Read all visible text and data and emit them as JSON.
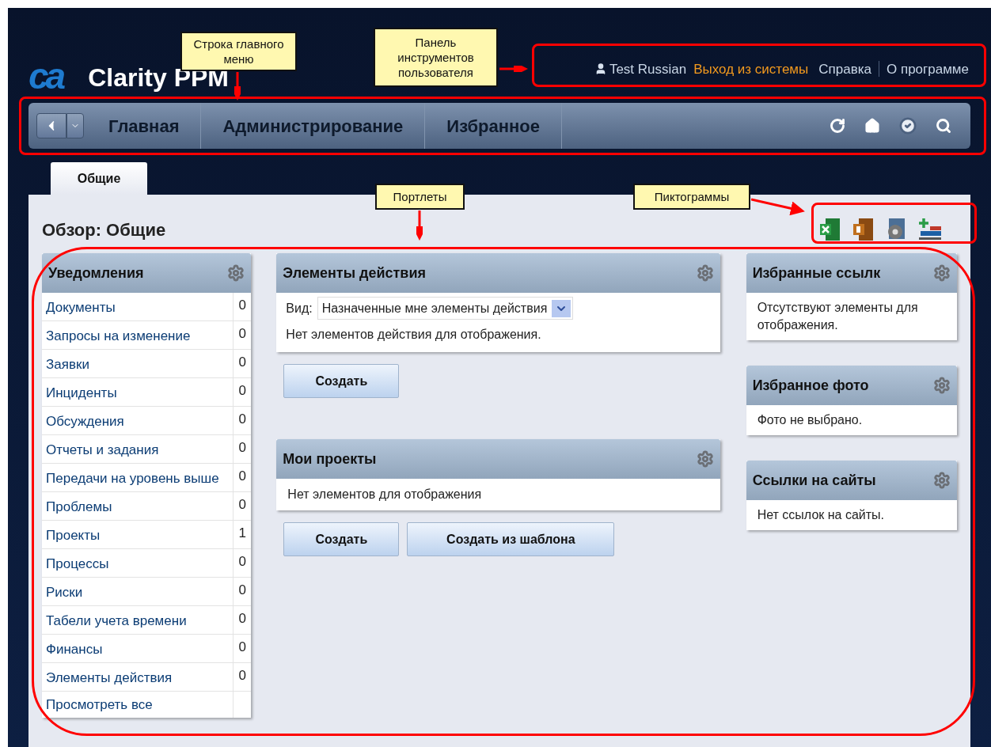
{
  "header": {
    "logo": "ca",
    "product": "Clarity PPM"
  },
  "user_toolbar": {
    "user": "Test Russian",
    "links": [
      {
        "label": "Выход из системы",
        "kind": "logout"
      },
      {
        "label": "Справка",
        "kind": "link"
      },
      {
        "label": "О программе",
        "kind": "link"
      }
    ]
  },
  "main_menu": {
    "items": [
      "Главная",
      "Администрирование",
      "Избранное"
    ]
  },
  "tabs": [
    {
      "label": "Общие",
      "selected": true
    }
  ],
  "page_title": "Обзор: Общие",
  "notifications": {
    "title": "Уведомления",
    "rows": [
      {
        "label": "Документы",
        "count": "0"
      },
      {
        "label": "Запросы на изменение",
        "count": "0"
      },
      {
        "label": "Заявки",
        "count": "0"
      },
      {
        "label": "Инциденты",
        "count": "0"
      },
      {
        "label": "Обсуждения",
        "count": "0"
      },
      {
        "label": "Отчеты и задания",
        "count": "0"
      },
      {
        "label": "Передачи на уровень выше",
        "count": "0"
      },
      {
        "label": "Проблемы",
        "count": "0"
      },
      {
        "label": "Проекты",
        "count": "1"
      },
      {
        "label": "Процессы",
        "count": "0"
      },
      {
        "label": "Риски",
        "count": "0"
      },
      {
        "label": "Табели учета времени",
        "count": "0"
      },
      {
        "label": "Финансы",
        "count": "0"
      },
      {
        "label": "Элементы действия",
        "count": "0"
      }
    ],
    "footer": "Просмотреть все"
  },
  "action_items": {
    "title": "Элементы действия",
    "view_label": "Вид:",
    "view_value": "Назначенные мне элементы действия",
    "empty": "Нет элементов действия для отображения.",
    "buttons": [
      "Создать"
    ]
  },
  "my_projects": {
    "title": "Мои проекты",
    "empty": "Нет элементов для отображения",
    "buttons": [
      "Создать",
      "Создать из шаблона"
    ]
  },
  "right_portlets": [
    {
      "title": "Избранные ссылк",
      "text": "Отсутствуют элементы для отображения."
    },
    {
      "title": "Избранное фото",
      "text": "Фото не выбрано."
    },
    {
      "title": "Ссылки на сайты",
      "text": "Нет ссылок на сайты."
    }
  ],
  "annotations": [
    {
      "kind": "main_menu",
      "text": "Строка главного меню"
    },
    {
      "kind": "user_toolbar",
      "text": "Панель инструментов пользователя"
    },
    {
      "kind": "portlets",
      "text": "Портлеты"
    },
    {
      "kind": "icons",
      "text": "Пиктограммы"
    }
  ]
}
